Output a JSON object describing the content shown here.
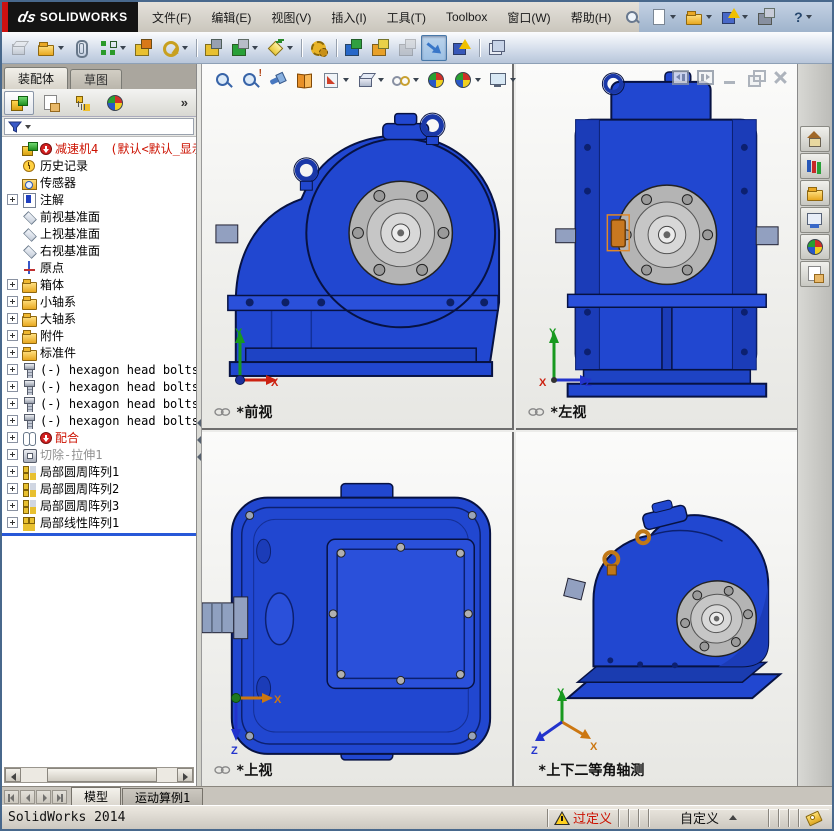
{
  "app": {
    "brand_mark": "ds",
    "brand": "SOLIDWORKS",
    "window_title": "SolidWorks 2014"
  },
  "colors": {
    "model_blue": "#2147d0",
    "model_blue_dark": "#1b3cb8",
    "hub_gray": "#b4b4b4",
    "warning_red": "#cc1100",
    "rollback_blue": "#2858d8",
    "highlight_orange": "#c87820"
  },
  "titlebar": {
    "menus": [
      {
        "name": "menu-file",
        "label": "文件(F)"
      },
      {
        "name": "menu-edit",
        "label": "编辑(E)"
      },
      {
        "name": "menu-view",
        "label": "视图(V)"
      },
      {
        "name": "menu-insert",
        "label": "插入(I)"
      },
      {
        "name": "menu-tools",
        "label": "工具(T)"
      },
      {
        "name": "menu-toolbox",
        "label": "Toolbox"
      },
      {
        "name": "menu-window",
        "label": "窗口(W)"
      },
      {
        "name": "menu-help",
        "label": "帮助(H)"
      }
    ],
    "quick_icons": [
      {
        "name": "new-document-button",
        "cls": "sh-page hasdd"
      },
      {
        "name": "open-button",
        "cls": "sh-folder hasdd"
      },
      {
        "name": "rebuild-button",
        "cls": "sh-warn hasdd",
        "c1": "#4868c8"
      },
      {
        "name": "file-properties-button",
        "cls": "sh-chip",
        "c1": "#8890a0",
        "c2": "#c8ccd8"
      },
      {
        "name": "help-button",
        "cls": "hasdd",
        "glyph": "?"
      }
    ]
  },
  "assembly_toolbar": [
    {
      "name": "insert-component-button",
      "cls": "sh-cube dis"
    },
    {
      "name": "open-insert-dropdown-button",
      "cls": "sh-folder hasdd"
    },
    {
      "name": "mate-button",
      "cls": "sh-clip"
    },
    {
      "name": "linear-component-pattern-button",
      "cls": "sh-dots hasdd",
      "c1": "#2a9a2a"
    },
    {
      "name": "smart-fasteners-button",
      "cls": "sh-chip",
      "c1": "#e8c030",
      "c2": "#d87818"
    },
    {
      "name": "move-component-button",
      "cls": "sh-ring hasdd",
      "c1": "#c8a020"
    },
    {
      "name": "separator",
      "cls": "sep"
    },
    {
      "name": "show-hidden-components-button",
      "cls": "sh-chip",
      "c1": "#e8c030",
      "c2": "#98a0b0"
    },
    {
      "name": "assembly-features-button",
      "cls": "sh-chip hasdd",
      "c1": "#28a038",
      "c2": "#b8bcc8"
    },
    {
      "name": "reference-geometry-button",
      "cls": "sh-diamond hasdd",
      "c1": "#e8c838"
    },
    {
      "name": "separator",
      "cls": "sep"
    },
    {
      "name": "new-motion-study-button",
      "cls": "sh-gear"
    },
    {
      "name": "separator",
      "cls": "sep"
    },
    {
      "name": "bill-of-materials-button",
      "cls": "sh-chip",
      "c1": "#2868c8",
      "c2": "#30a040"
    },
    {
      "name": "exploded-view-button",
      "cls": "sh-chip",
      "c1": "#e8a028",
      "c2": "#e8d048"
    },
    {
      "name": "explode-line-sketch-button",
      "cls": "sh-chip dis",
      "c1": "#9aa4b0",
      "c2": "#bcc4d0"
    },
    {
      "name": "interference-detection-button",
      "cls": "sh-arrow act"
    },
    {
      "name": "assembly-xpert-button",
      "cls": "sh-warn",
      "c1": "#3858b8"
    },
    {
      "name": "separator",
      "cls": "sep"
    },
    {
      "name": "take-snapshot-button",
      "cls": "sh-snap"
    }
  ],
  "hud_toolbar": [
    {
      "name": "zoom-to-fit-button",
      "cls": "sh-mag"
    },
    {
      "name": "zoom-to-area-button",
      "cls": "sh-mag warnmark",
      "glyph": "!"
    },
    {
      "name": "previous-view-button",
      "cls": "sh-flash"
    },
    {
      "name": "section-view-button",
      "cls": "sh-book"
    },
    {
      "name": "view-orientation-button",
      "cls": "sh-vo hasdd"
    },
    {
      "name": "display-style-button",
      "cls": "sh-cube hasdd"
    },
    {
      "name": "hide-show-items-button",
      "cls": "sh-glasses hasdd"
    },
    {
      "name": "edit-appearance-button",
      "cls": "sh-ball"
    },
    {
      "name": "apply-scene-button",
      "cls": "sh-ball hasdd"
    },
    {
      "name": "view-settings-button",
      "cls": "sh-monitor hasdd"
    }
  ],
  "left_panel": {
    "tabs": [
      {
        "name": "tab-assembly",
        "label": "装配体",
        "cls": ""
      },
      {
        "name": "tab-sketch",
        "label": "草图",
        "cls": "inactive"
      }
    ],
    "manager_tabs": [
      {
        "name": "featuremanager-tree-tab",
        "cls": "sh-asmtab act"
      },
      {
        "name": "propertymanager-tab",
        "cls": "sh-form"
      },
      {
        "name": "configurationmanager-tab",
        "cls": "sh-config"
      },
      {
        "name": "displaymanager-tab",
        "cls": "sh-ball"
      }
    ],
    "expand_arrows": "»",
    "tree": [
      {
        "name": "tree-item-reducer-assembly",
        "label": "减速机4",
        "suffix": "(默认<默认_显示状",
        "cls": "ti-asm hasbadge red"
      },
      {
        "name": "tree-item-history",
        "label": "历史记录",
        "cls": "ti-hist"
      },
      {
        "name": "tree-item-sensors",
        "label": "传感器",
        "cls": "ti-sens"
      },
      {
        "name": "tree-item-annotations",
        "label": "注解",
        "cls": "ti-ann has-exp"
      },
      {
        "name": "tree-item-front-plane",
        "label": "前视基准面",
        "cls": "ti-plane"
      },
      {
        "name": "tree-item-top-plane",
        "label": "上视基准面",
        "cls": "ti-plane"
      },
      {
        "name": "tree-item-right-plane",
        "label": "右视基准面",
        "cls": "ti-plane"
      },
      {
        "name": "tree-item-origin",
        "label": "原点",
        "cls": "ti-origin"
      },
      {
        "name": "tree-item-housing-folder",
        "label": "箱体",
        "cls": "ti-folder has-exp"
      },
      {
        "name": "tree-item-small-shaft-folder",
        "label": "小轴系",
        "cls": "ti-folder has-exp"
      },
      {
        "name": "tree-item-large-shaft-folder",
        "label": "大轴系",
        "cls": "ti-folder has-exp"
      },
      {
        "name": "tree-item-attachments-folder",
        "label": "附件",
        "cls": "ti-folder has-exp"
      },
      {
        "name": "tree-item-standard-parts-folder",
        "label": "标准件",
        "cls": "ti-folder has-exp"
      },
      {
        "name": "tree-item-hexagon-bolt-1",
        "label": "(-) hexagon head bolts-fu",
        "cls": "ti-bolt has-exp"
      },
      {
        "name": "tree-item-hexagon-bolt-2",
        "label": "(-) hexagon head bolts-fu",
        "cls": "ti-bolt has-exp"
      },
      {
        "name": "tree-item-hexagon-bolt-3",
        "label": "(-) hexagon head bolts-fu",
        "cls": "ti-bolt has-exp"
      },
      {
        "name": "tree-item-hexagon-bolt-4",
        "label": "(-) hexagon head bolts-fu",
        "cls": "ti-bolt has-exp"
      },
      {
        "name": "tree-item-mates",
        "label": "配合",
        "cls": "ti-clip has-exp hasbadge red"
      },
      {
        "name": "tree-item-cut-extrude-1",
        "label": "切除-拉伸1",
        "cls": "ti-cut has-exp gray"
      },
      {
        "name": "tree-item-circular-pattern-1",
        "label": "局部圆周阵列1",
        "cls": "ti-pattern has-exp"
      },
      {
        "name": "tree-item-circular-pattern-2",
        "label": "局部圆周阵列2",
        "cls": "ti-pattern has-exp"
      },
      {
        "name": "tree-item-circular-pattern-3",
        "label": "局部圆周阵列3",
        "cls": "ti-pattern has-exp"
      },
      {
        "name": "tree-item-linear-pattern-1",
        "label": "局部线性阵列1",
        "cls": "ti-patternL has-exp"
      }
    ]
  },
  "viewports": [
    {
      "label": "*前视",
      "triad": {
        "up": "Y",
        "right": "X"
      }
    },
    {
      "label": "*左视",
      "triad": {
        "up": "Y",
        "right": "Z",
        "origin": "X"
      }
    },
    {
      "label": "*上视",
      "triad": {
        "right": "X",
        "down": "Z"
      }
    },
    {
      "label": "*上下二等角轴测",
      "triad": {
        "up": "Y",
        "right": "X",
        "left": "Z"
      }
    }
  ],
  "task_pane": [
    {
      "name": "solidworks-resources-tab",
      "cls": "sh-home"
    },
    {
      "name": "design-library-tab",
      "cls": "sh-books"
    },
    {
      "name": "file-explorer-tab",
      "cls": "sh-folder"
    },
    {
      "name": "view-palette-tab",
      "cls": "sh-viewpal"
    },
    {
      "name": "appearances-scenes-tab",
      "cls": "sh-ball"
    },
    {
      "name": "custom-properties-tab",
      "cls": "sh-form"
    }
  ],
  "bottom": {
    "tabs": [
      {
        "name": "model-tab",
        "label": "模型",
        "cls": ""
      },
      {
        "name": "motion-study-tab",
        "label": "运动算例1",
        "cls": "inactive"
      }
    ],
    "status_left": "SolidWorks 2014",
    "overdefined": "过定义",
    "custom": "自定义"
  }
}
